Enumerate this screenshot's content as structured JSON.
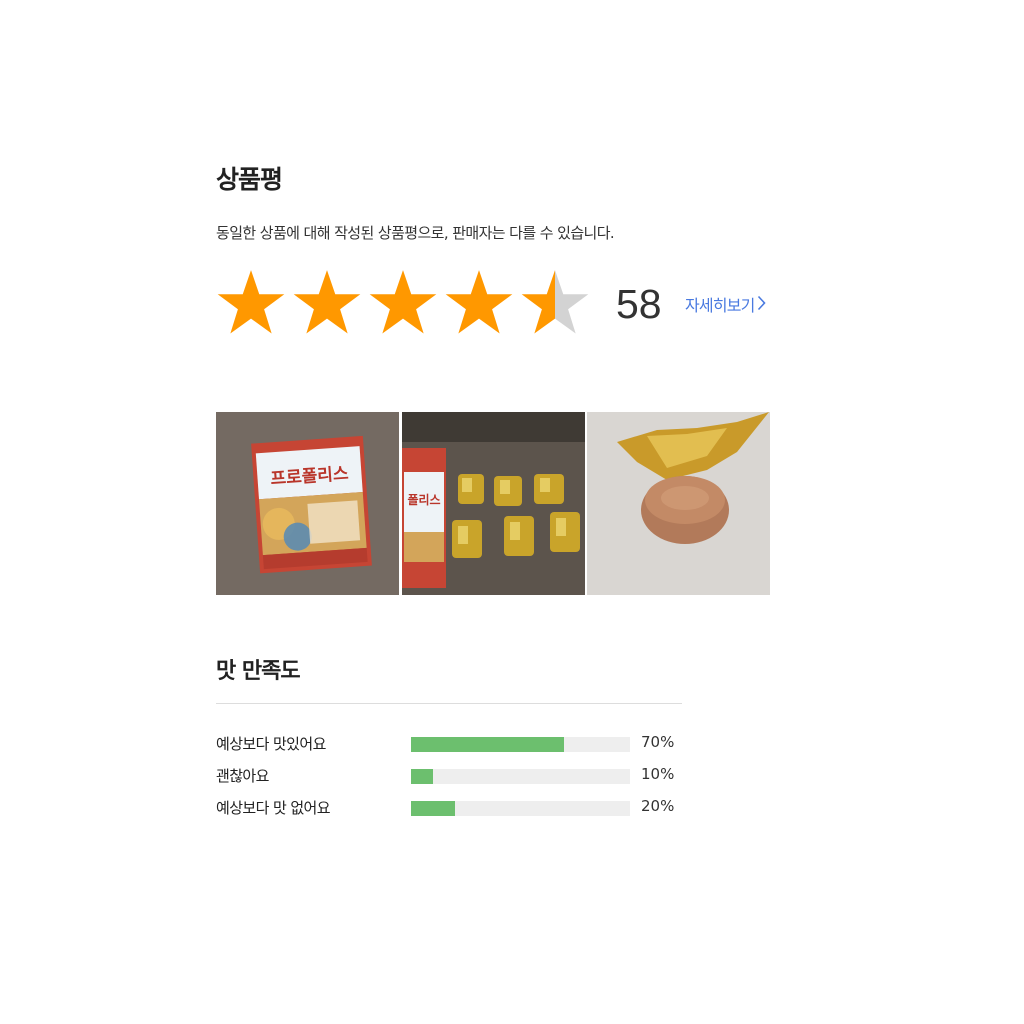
{
  "review": {
    "title": "상품평",
    "subtitle": "동일한 상품에 대해 작성된 상품평으로, 판매자는 다를 수 있습니다.",
    "rating": 4.5,
    "max_rating": 5,
    "review_count": "58",
    "more_link_label": "자세히보기",
    "more_link_icon": "chevron-right-icon",
    "star_color_filled": "#ff9800",
    "star_color_empty": "#d3d3d3"
  },
  "photos": [
    {
      "name": "review-photo-1",
      "subject": "product box",
      "box_label": "프로폴리스"
    },
    {
      "name": "review-photo-2",
      "subject": "wrapped candies",
      "box_label": "폴리스"
    },
    {
      "name": "review-photo-3",
      "subject": "unwrapped candy"
    }
  ],
  "taste": {
    "title": "맛 만족도",
    "bar_color": "#6cbf6e",
    "track_color": "#eeeeee",
    "rows": [
      {
        "label": "예상보다 맛있어요",
        "percent": 70,
        "percent_label": "70%"
      },
      {
        "label": "괜찮아요",
        "percent": 10,
        "percent_label": "10%"
      },
      {
        "label": "예상보다 맛 없어요",
        "percent": 20,
        "percent_label": "20%"
      }
    ]
  }
}
